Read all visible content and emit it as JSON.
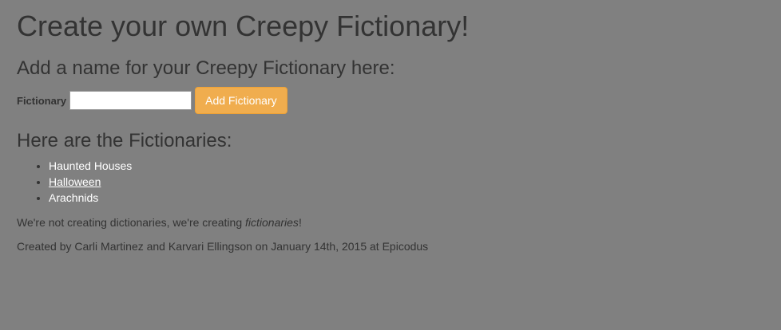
{
  "page": {
    "title": "Create your own Creepy Fictionary!",
    "background_color": "#808080"
  },
  "form": {
    "heading": "Add a name for your Creepy Fictionary here:",
    "label": "Fictionary",
    "input_value": "",
    "button_label": "Add Fictionary",
    "button_color": "#f0ad4e"
  },
  "list": {
    "heading": "Here are the Fictionaries:",
    "items": [
      {
        "label": "Haunted Houses"
      },
      {
        "label": "Halloween"
      },
      {
        "label": "Arachnids"
      }
    ]
  },
  "footer": {
    "tagline_prefix": "We're not creating dictionaries, we're creating ",
    "tagline_emphasis": "fictionaries",
    "tagline_suffix": "!",
    "credits": "Created by Carli Martinez and Karvari Ellingson on January 14th, 2015 at Epicodus"
  }
}
